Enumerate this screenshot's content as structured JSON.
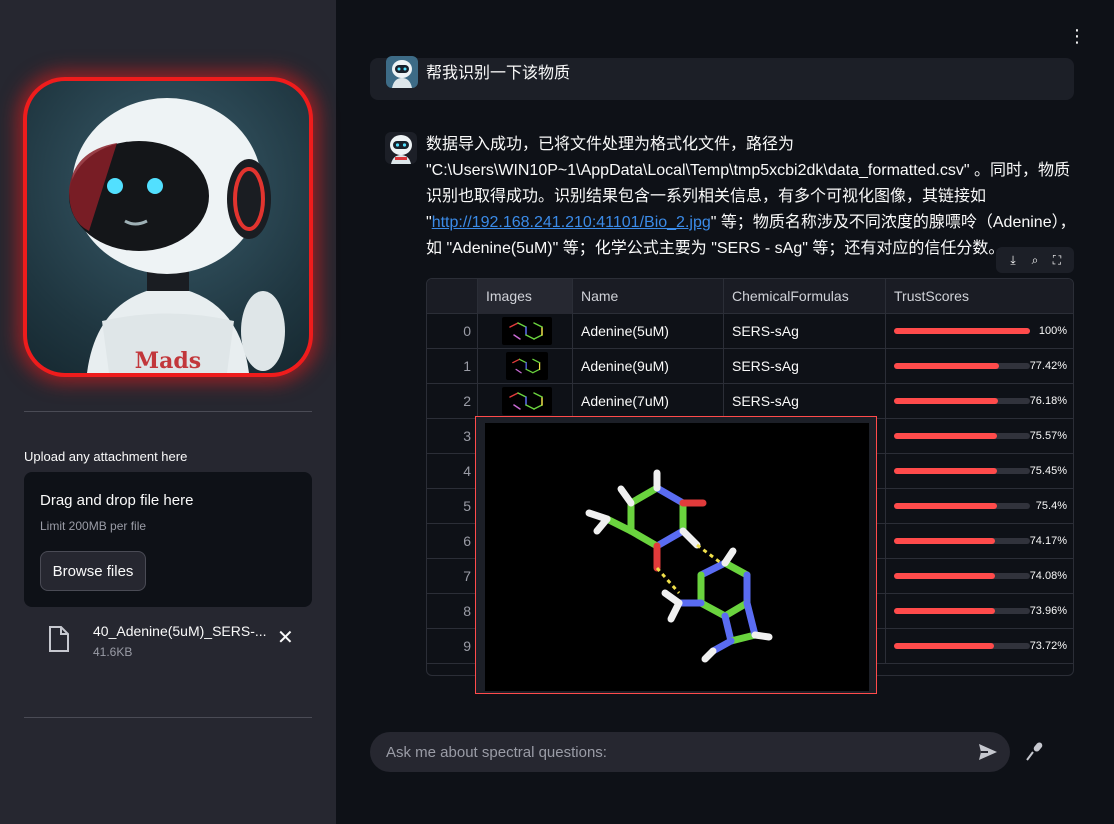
{
  "sidebar": {
    "avatar_text": "Mads",
    "upload": {
      "label": "Upload any attachment here",
      "drop_title": "Drag and drop file here",
      "drop_limit": "Limit 200MB per file",
      "browse_label": "Browse files"
    },
    "file": {
      "name": "40_Adenine(5uM)_SERS-...",
      "size": "41.6KB"
    }
  },
  "header": {
    "menu_icon": "kebab-menu-icon"
  },
  "chat": {
    "user_message": "帮我识别一下该物质",
    "assistant_message": {
      "part1": "数据导入成功，已将文件处理为格式化文件，路径为 \"C:\\Users\\WIN10P~1\\AppData\\Local\\Temp\\tmp5xcbi2dk\\data_formatted.csv\" 。同时，物质识别也取得成功。识别结果包含一系列相关信息，有多个可视化图像，其链接如 \"",
      "link": "http://192.168.241.210:41101/Bio_2.jpg",
      "part2": "\" 等；物质名称涉及不同浓度的腺嘌呤（Adenine），如 \"Adenine(5uM)\" 等；化学公式主要为 \"SERS - sAg\" 等；还有对应的信任分数。"
    }
  },
  "table": {
    "toolbar": [
      "download-icon",
      "search-icon",
      "fullscreen-icon"
    ],
    "columns": [
      "",
      "Images",
      "Name",
      "ChemicalFormulas",
      "TrustScores"
    ],
    "rows": [
      {
        "idx": "0",
        "name": "Adenine(5uM)",
        "formula": "SERS-sAg",
        "score": 1.0,
        "score_label": "100%"
      },
      {
        "idx": "1",
        "name": "Adenine(9uM)",
        "formula": "SERS-sAg",
        "score": 0.7742,
        "score_label": "77.42%"
      },
      {
        "idx": "2",
        "name": "Adenine(7uM)",
        "formula": "SERS-sAg",
        "score": 0.7618,
        "score_label": "76.18%"
      },
      {
        "idx": "3",
        "name": "",
        "formula": "",
        "score": 0.7557,
        "score_label": "75.57%"
      },
      {
        "idx": "4",
        "name": "",
        "formula": "",
        "score": 0.7545,
        "score_label": "75.45%"
      },
      {
        "idx": "5",
        "name": "",
        "formula": "",
        "score": 0.754,
        "score_label": "75.4%"
      },
      {
        "idx": "6",
        "name": "",
        "formula": "",
        "score": 0.7417,
        "score_label": "74.17%"
      },
      {
        "idx": "7",
        "name": "",
        "formula": "",
        "score": 0.7408,
        "score_label": "74.08%"
      },
      {
        "idx": "8",
        "name": "",
        "formula": "",
        "score": 0.7396,
        "score_label": "73.96%"
      },
      {
        "idx": "9",
        "name": "",
        "formula": "",
        "score": 0.7372,
        "score_label": "73.72%"
      }
    ]
  },
  "input": {
    "placeholder": "Ask me about spectral questions:"
  },
  "colors": {
    "accent": "#ff4b4b",
    "link": "#3b8be8",
    "background": "#0e1117",
    "sidebar": "#262730"
  }
}
